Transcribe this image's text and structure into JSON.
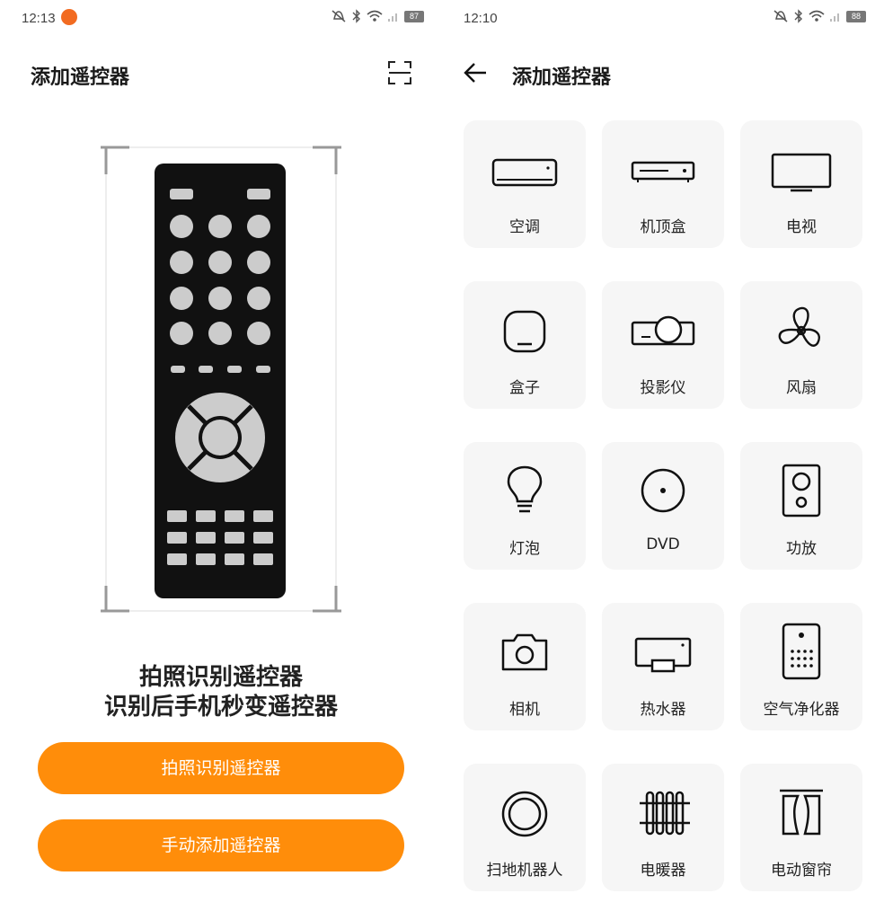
{
  "left": {
    "status": {
      "time": "12:13",
      "battery": "87"
    },
    "title": "添加遥控器",
    "caption_line1": "拍照识别遥控器",
    "caption_line2": "识别后手机秒变遥控器",
    "photo_button": "拍照识别遥控器",
    "manual_button": "手动添加遥控器"
  },
  "right": {
    "status": {
      "time": "12:10",
      "battery": "88"
    },
    "title": "添加遥控器",
    "devices": [
      {
        "label": "空调",
        "icon": "air-conditioner-icon"
      },
      {
        "label": "机顶盒",
        "icon": "set-top-box-icon"
      },
      {
        "label": "电视",
        "icon": "tv-icon"
      },
      {
        "label": "盒子",
        "icon": "box-icon"
      },
      {
        "label": "投影仪",
        "icon": "projector-icon"
      },
      {
        "label": "风扇",
        "icon": "fan-icon"
      },
      {
        "label": "灯泡",
        "icon": "light-bulb-icon"
      },
      {
        "label": "DVD",
        "icon": "dvd-icon"
      },
      {
        "label": "功放",
        "icon": "amplifier-icon"
      },
      {
        "label": "相机",
        "icon": "camera-icon"
      },
      {
        "label": "热水器",
        "icon": "water-heater-icon"
      },
      {
        "label": "空气净化器",
        "icon": "air-purifier-icon"
      },
      {
        "label": "扫地机器人",
        "icon": "robot-vacuum-icon"
      },
      {
        "label": "电暖器",
        "icon": "heater-icon"
      },
      {
        "label": "电动窗帘",
        "icon": "curtain-icon"
      }
    ]
  },
  "colors": {
    "accent": "#ff8d0a",
    "card": "#f6f6f6",
    "notification": "#f26b21"
  }
}
